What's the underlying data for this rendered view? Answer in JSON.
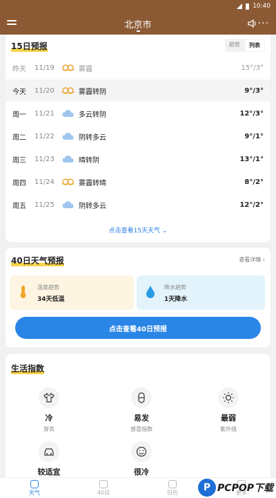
{
  "status": {
    "time": "10:40"
  },
  "header": {
    "city": "北京市"
  },
  "forecast15": {
    "title": "15日预报",
    "toggle": {
      "trend": "趋势",
      "list": "列表"
    },
    "days": [
      {
        "name": "昨天",
        "date": "11/19",
        "weather": "雾霾",
        "temp": "15°/3°",
        "icon": "haze-icon"
      },
      {
        "name": "今天",
        "date": "11/20",
        "weather": "雾霾转阴",
        "temp": "9°/3°",
        "icon": "haze-icon"
      },
      {
        "name": "周一",
        "date": "11/21",
        "weather": "多云转阴",
        "temp": "12°/3°",
        "icon": "cloud-icon"
      },
      {
        "name": "周二",
        "date": "11/22",
        "weather": "阴转多云",
        "temp": "9°/1°",
        "icon": "cloud-icon"
      },
      {
        "name": "周三",
        "date": "11/23",
        "weather": "晴转阴",
        "temp": "13°/1°",
        "icon": "cloud-icon"
      },
      {
        "name": "周四",
        "date": "11/24",
        "weather": "雾霾转晴",
        "temp": "8°/2°",
        "icon": "haze-icon"
      },
      {
        "name": "周五",
        "date": "11/25",
        "weather": "阴转多云",
        "temp": "12°/2°",
        "icon": "cloud-icon"
      }
    ],
    "more_link": "点击查看15天天气"
  },
  "forecast40": {
    "title": "40日天气预报",
    "detail_link": "查看详情",
    "temp_trend": {
      "label": "温度趋势",
      "value": "34天低温"
    },
    "rain_trend": {
      "label": "降水趋势",
      "value": "1天降水"
    },
    "button": "点击查看40日预报"
  },
  "life": {
    "title": "生活指数",
    "items": [
      {
        "value": "冷",
        "name": "穿衣",
        "icon": "shirt-icon"
      },
      {
        "value": "易发",
        "name": "感冒指数",
        "icon": "pill-icon"
      },
      {
        "value": "最弱",
        "name": "紫外线",
        "icon": "sun-icon"
      },
      {
        "value": "较适宜",
        "name": "",
        "icon": "car-icon"
      },
      {
        "value": "很冷",
        "name": "",
        "icon": "smile-icon"
      }
    ]
  },
  "tabs": [
    {
      "label": "天气",
      "icon": "home-icon"
    },
    {
      "label": "40日",
      "icon": "play-icon"
    },
    {
      "label": "日历",
      "icon": "calendar-icon"
    },
    {
      "label": "更多",
      "icon": "more-icon"
    }
  ],
  "watermark": {
    "text": "PCPOP下载",
    "letter": "P"
  },
  "colors": {
    "brand": "#8b5a34",
    "accent": "#2a86e6",
    "highlight": "#f7d44a"
  }
}
